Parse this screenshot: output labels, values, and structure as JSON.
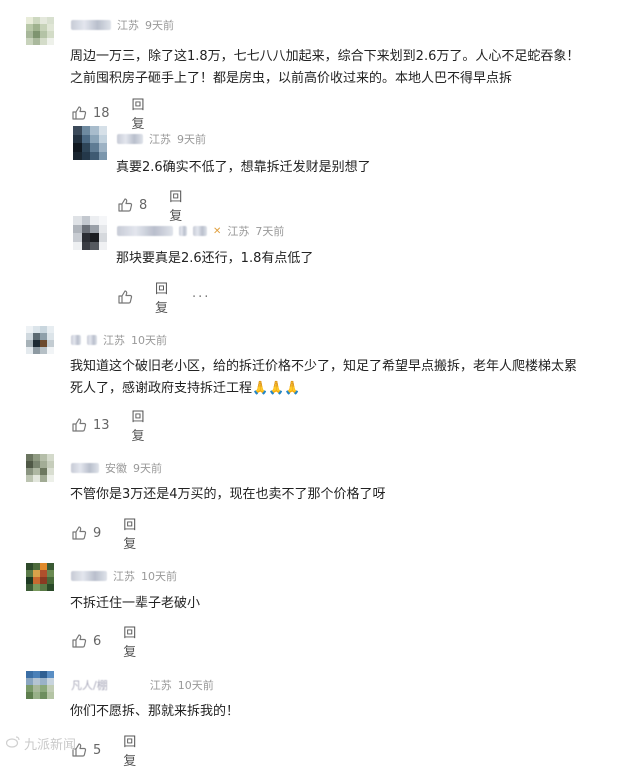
{
  "comments": [
    {
      "location": "江苏",
      "time": "9天前",
      "text1": "周边一万三，除了这1.8万，七七八八加起来，综合下来划到2.6万了。人心不足蛇吞象！",
      "text2": "之前囤积房子砸手上了！都是房虫，以前高价收过来的。本地人巴不得早点拆",
      "likes": "18",
      "reply": "回复"
    },
    {
      "location": "江苏",
      "time": "9天前",
      "text1": "真要2.6确实不低了，想靠拆迁发财是别想了",
      "likes": "8",
      "reply": "回复"
    },
    {
      "location": "江苏",
      "time": "7天前",
      "text1": "那块要真是2.6还行，1.8有点低了",
      "reply": "回复",
      "more": "···"
    },
    {
      "location": "江苏",
      "time": "10天前",
      "text1": "我知道这个破旧老小区，给的拆迁价格不少了，知足了希望早点搬拆，老年人爬楼梯太累",
      "text2": "死人了，感谢政府支持拆迁工程🙏🙏🙏",
      "likes": "13",
      "reply": "回复"
    },
    {
      "location": "安徽",
      "time": "9天前",
      "text1": "不管你是3万还是4万买的，现在也卖不了那个价格了呀",
      "likes": "9",
      "reply": "回复"
    },
    {
      "location": "江苏",
      "time": "10天前",
      "text1": "不拆迁住一辈子老破小",
      "likes": "6",
      "reply": "回复"
    },
    {
      "user": "凡人/棚",
      "location": "江苏",
      "time": "10天前",
      "text1": "你们不愿拆、那就来拆我的！",
      "likes": "5",
      "reply": "回复"
    }
  ],
  "watermark": "九派新闻"
}
